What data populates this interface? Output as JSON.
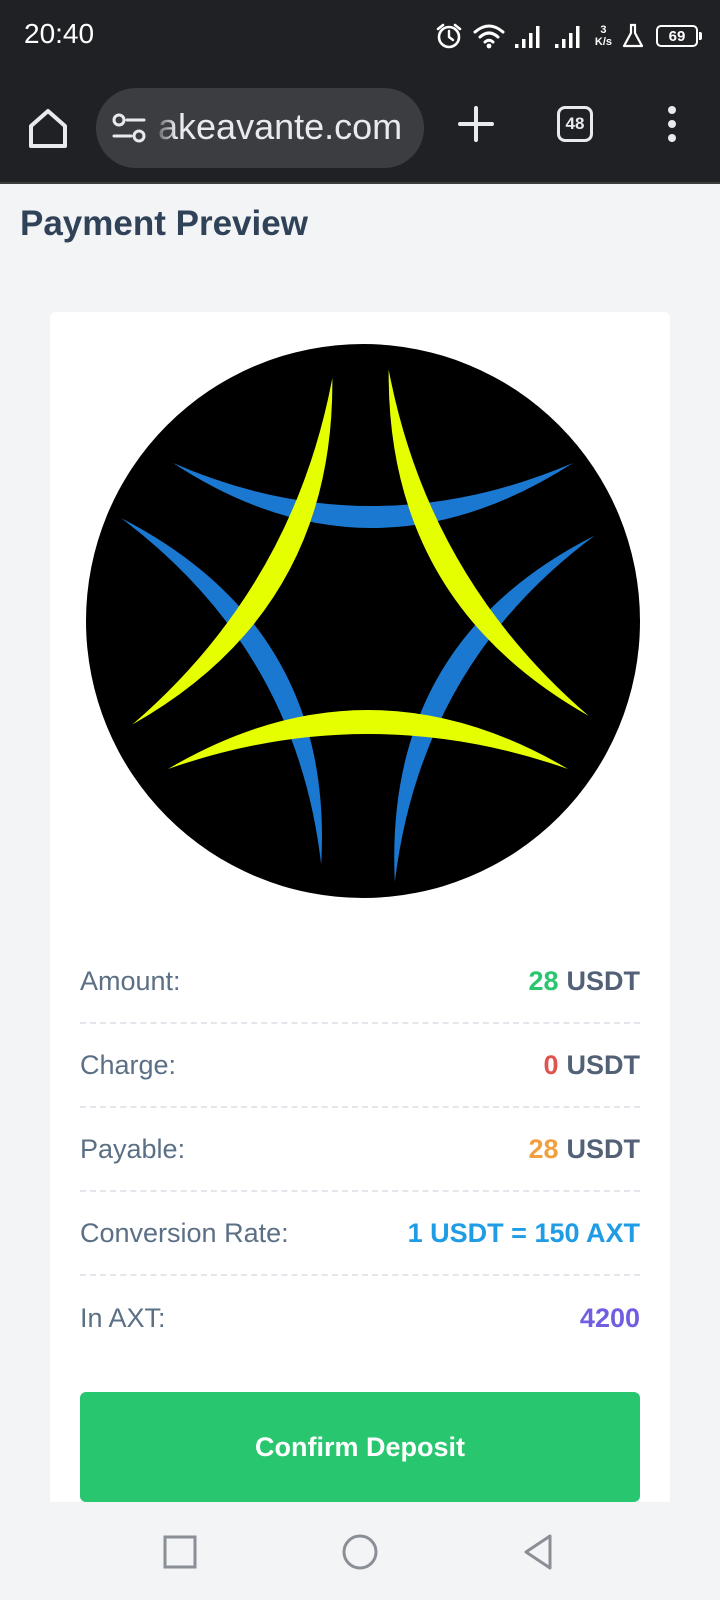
{
  "status_bar": {
    "time": "20:40",
    "net_speed_value": "3",
    "net_speed_unit": "K/s",
    "battery": "69"
  },
  "browser": {
    "url": "akeavante.com",
    "tab_count": "48"
  },
  "page": {
    "title": "Payment Preview"
  },
  "payment": {
    "rows": [
      {
        "label": "Amount:",
        "number": "28",
        "unit": "USDT",
        "number_color": "#28c66f"
      },
      {
        "label": "Charge:",
        "number": "0",
        "unit": "USDT",
        "number_color": "#e0534f"
      },
      {
        "label": "Payable:",
        "number": "28",
        "unit": "USDT",
        "number_color": "#f2a03f"
      },
      {
        "label": "Conversion Rate:",
        "value": "1 USDT = 150 AXT",
        "value_color": "#1f9ce4"
      },
      {
        "label": "In AXT:",
        "value": "4200",
        "value_color": "#6f5fe0"
      }
    ],
    "confirm_label": "Confirm Deposit"
  },
  "colors": {
    "accent_green": "#28c66f",
    "logo_yellow": "#e6ff00",
    "logo_blue": "#1b78d0"
  }
}
